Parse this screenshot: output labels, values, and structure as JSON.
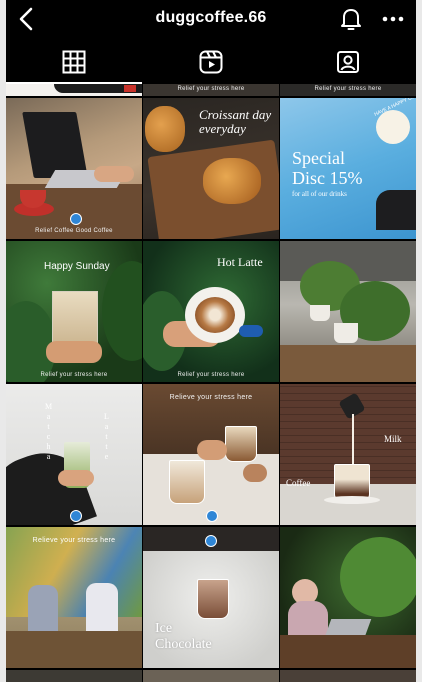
{
  "header": {
    "username": "duggcoffee.66"
  },
  "tabs": [
    {
      "name": "grid",
      "icon": "grid-icon",
      "active": true
    },
    {
      "name": "reels",
      "icon": "reels-icon",
      "active": false
    },
    {
      "name": "tagged",
      "icon": "tagged-icon",
      "active": false
    }
  ],
  "posts": {
    "top_strip": [
      "Relief your stress here",
      "Relief your stress here"
    ],
    "p1": {
      "caption": "Relief Coffee Good Coffee"
    },
    "p2": {
      "script": "Croissant day everyday"
    },
    "p3": {
      "title_line1": "Special",
      "title_line2": "Disc 15%",
      "subtitle": "for all of our drinks",
      "stamp": "HAVE A HAPPY COFFEE"
    },
    "p4": {
      "title": "Happy Sunday",
      "caption": "Relief your stress here"
    },
    "p5": {
      "title": "Hot Latte",
      "caption": "Relief your stress here"
    },
    "p7": {
      "word_left": "Matcha",
      "word_right": "Latte"
    },
    "p8": {
      "caption": "Relieve your stress here"
    },
    "p9": {
      "label_milk": "Milk",
      "label_coffee": "Coffee"
    },
    "p10": {
      "caption": "Relieve your stress here"
    },
    "p11": {
      "title_line1": "Ice",
      "title_line2": "Chocolate"
    }
  },
  "colors": {
    "background": "#000000",
    "text": "#ffffff",
    "brand_badge": "#2f86d6"
  }
}
